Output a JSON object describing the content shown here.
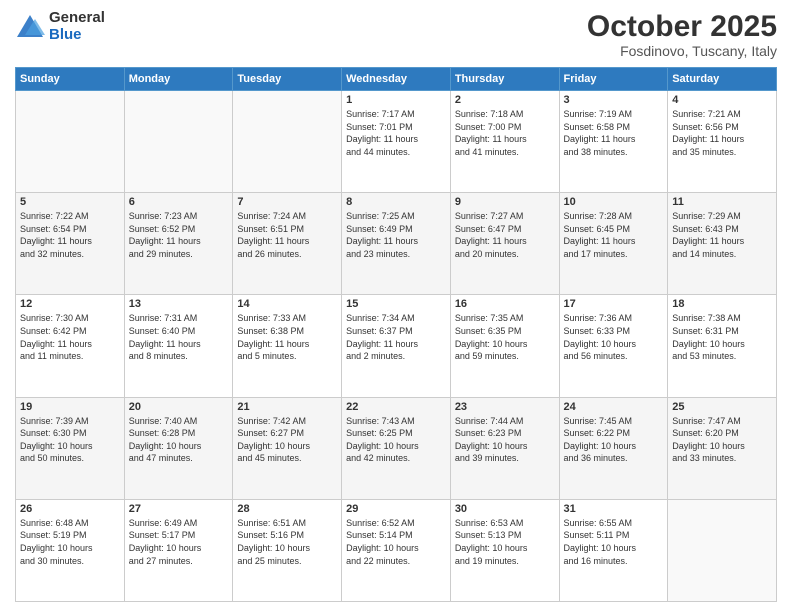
{
  "logo": {
    "general": "General",
    "blue": "Blue"
  },
  "header": {
    "title": "October 2025",
    "subtitle": "Fosdinovo, Tuscany, Italy"
  },
  "weekdays": [
    "Sunday",
    "Monday",
    "Tuesday",
    "Wednesday",
    "Thursday",
    "Friday",
    "Saturday"
  ],
  "weeks": [
    [
      {
        "day": "",
        "info": ""
      },
      {
        "day": "",
        "info": ""
      },
      {
        "day": "",
        "info": ""
      },
      {
        "day": "1",
        "info": "Sunrise: 7:17 AM\nSunset: 7:01 PM\nDaylight: 11 hours\nand 44 minutes."
      },
      {
        "day": "2",
        "info": "Sunrise: 7:18 AM\nSunset: 7:00 PM\nDaylight: 11 hours\nand 41 minutes."
      },
      {
        "day": "3",
        "info": "Sunrise: 7:19 AM\nSunset: 6:58 PM\nDaylight: 11 hours\nand 38 minutes."
      },
      {
        "day": "4",
        "info": "Sunrise: 7:21 AM\nSunset: 6:56 PM\nDaylight: 11 hours\nand 35 minutes."
      }
    ],
    [
      {
        "day": "5",
        "info": "Sunrise: 7:22 AM\nSunset: 6:54 PM\nDaylight: 11 hours\nand 32 minutes."
      },
      {
        "day": "6",
        "info": "Sunrise: 7:23 AM\nSunset: 6:52 PM\nDaylight: 11 hours\nand 29 minutes."
      },
      {
        "day": "7",
        "info": "Sunrise: 7:24 AM\nSunset: 6:51 PM\nDaylight: 11 hours\nand 26 minutes."
      },
      {
        "day": "8",
        "info": "Sunrise: 7:25 AM\nSunset: 6:49 PM\nDaylight: 11 hours\nand 23 minutes."
      },
      {
        "day": "9",
        "info": "Sunrise: 7:27 AM\nSunset: 6:47 PM\nDaylight: 11 hours\nand 20 minutes."
      },
      {
        "day": "10",
        "info": "Sunrise: 7:28 AM\nSunset: 6:45 PM\nDaylight: 11 hours\nand 17 minutes."
      },
      {
        "day": "11",
        "info": "Sunrise: 7:29 AM\nSunset: 6:43 PM\nDaylight: 11 hours\nand 14 minutes."
      }
    ],
    [
      {
        "day": "12",
        "info": "Sunrise: 7:30 AM\nSunset: 6:42 PM\nDaylight: 11 hours\nand 11 minutes."
      },
      {
        "day": "13",
        "info": "Sunrise: 7:31 AM\nSunset: 6:40 PM\nDaylight: 11 hours\nand 8 minutes."
      },
      {
        "day": "14",
        "info": "Sunrise: 7:33 AM\nSunset: 6:38 PM\nDaylight: 11 hours\nand 5 minutes."
      },
      {
        "day": "15",
        "info": "Sunrise: 7:34 AM\nSunset: 6:37 PM\nDaylight: 11 hours\nand 2 minutes."
      },
      {
        "day": "16",
        "info": "Sunrise: 7:35 AM\nSunset: 6:35 PM\nDaylight: 10 hours\nand 59 minutes."
      },
      {
        "day": "17",
        "info": "Sunrise: 7:36 AM\nSunset: 6:33 PM\nDaylight: 10 hours\nand 56 minutes."
      },
      {
        "day": "18",
        "info": "Sunrise: 7:38 AM\nSunset: 6:31 PM\nDaylight: 10 hours\nand 53 minutes."
      }
    ],
    [
      {
        "day": "19",
        "info": "Sunrise: 7:39 AM\nSunset: 6:30 PM\nDaylight: 10 hours\nand 50 minutes."
      },
      {
        "day": "20",
        "info": "Sunrise: 7:40 AM\nSunset: 6:28 PM\nDaylight: 10 hours\nand 47 minutes."
      },
      {
        "day": "21",
        "info": "Sunrise: 7:42 AM\nSunset: 6:27 PM\nDaylight: 10 hours\nand 45 minutes."
      },
      {
        "day": "22",
        "info": "Sunrise: 7:43 AM\nSunset: 6:25 PM\nDaylight: 10 hours\nand 42 minutes."
      },
      {
        "day": "23",
        "info": "Sunrise: 7:44 AM\nSunset: 6:23 PM\nDaylight: 10 hours\nand 39 minutes."
      },
      {
        "day": "24",
        "info": "Sunrise: 7:45 AM\nSunset: 6:22 PM\nDaylight: 10 hours\nand 36 minutes."
      },
      {
        "day": "25",
        "info": "Sunrise: 7:47 AM\nSunset: 6:20 PM\nDaylight: 10 hours\nand 33 minutes."
      }
    ],
    [
      {
        "day": "26",
        "info": "Sunrise: 6:48 AM\nSunset: 5:19 PM\nDaylight: 10 hours\nand 30 minutes."
      },
      {
        "day": "27",
        "info": "Sunrise: 6:49 AM\nSunset: 5:17 PM\nDaylight: 10 hours\nand 27 minutes."
      },
      {
        "day": "28",
        "info": "Sunrise: 6:51 AM\nSunset: 5:16 PM\nDaylight: 10 hours\nand 25 minutes."
      },
      {
        "day": "29",
        "info": "Sunrise: 6:52 AM\nSunset: 5:14 PM\nDaylight: 10 hours\nand 22 minutes."
      },
      {
        "day": "30",
        "info": "Sunrise: 6:53 AM\nSunset: 5:13 PM\nDaylight: 10 hours\nand 19 minutes."
      },
      {
        "day": "31",
        "info": "Sunrise: 6:55 AM\nSunset: 5:11 PM\nDaylight: 10 hours\nand 16 minutes."
      },
      {
        "day": "",
        "info": ""
      }
    ]
  ]
}
